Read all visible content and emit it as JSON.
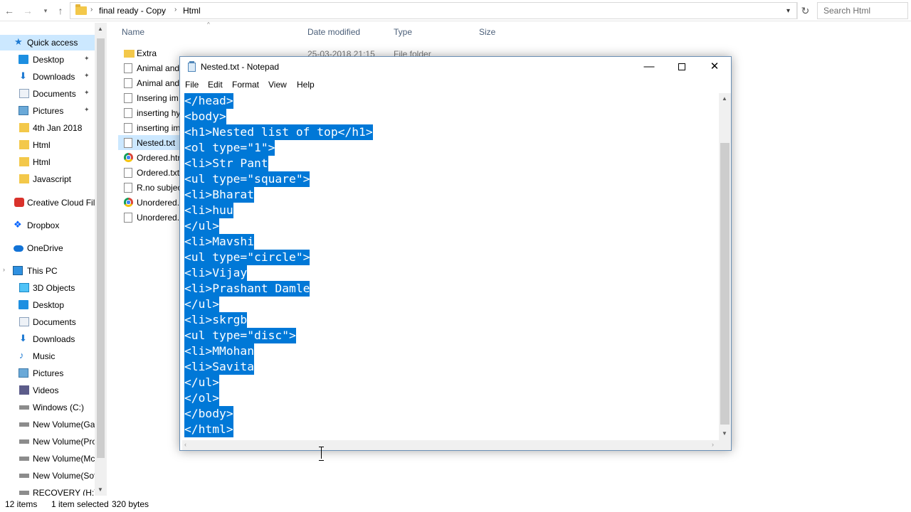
{
  "explorer": {
    "breadcrumb": [
      "final ready - Copy",
      "Html"
    ],
    "search_placeholder": "Search Html",
    "columns": {
      "name": "Name",
      "date": "Date modified",
      "type": "Type",
      "size": "Size"
    },
    "ghost_date": "25-03-2018 21:15",
    "ghost_type": "File folder",
    "nav": {
      "quick_access": "Quick access",
      "quick_items": [
        "Desktop",
        "Downloads",
        "Documents",
        "Pictures",
        "4th Jan 2018",
        "Html",
        "Html",
        "Javascript"
      ],
      "creative_cloud": "Creative Cloud Fil",
      "dropbox": "Dropbox",
      "onedrive": "OneDrive",
      "this_pc": "This PC",
      "pc_items": [
        "3D Objects",
        "Desktop",
        "Documents",
        "Downloads",
        "Music",
        "Pictures",
        "Videos",
        "Windows (C:)",
        "New Volume(Ga",
        "New Volume(Pro",
        "New Volume(Mc",
        "New Volume(Sof",
        "RECOVERY (H:)"
      ]
    },
    "files": [
      "Extra",
      "Animal and",
      "Animal and",
      "Insering im",
      "inserting hy",
      "inserting im",
      "Nested.txt",
      "Ordered.htr",
      "Ordered.txt",
      "R.no subjec",
      "Unordered.",
      "Unordered."
    ],
    "status": {
      "items": "12 items",
      "selected": "1 item selected",
      "size": "320 bytes"
    }
  },
  "notepad": {
    "title": "Nested.txt - Notepad",
    "menu": [
      "File",
      "Edit",
      "Format",
      "View",
      "Help"
    ],
    "lines": [
      "</head>",
      "<body>",
      "<h1>Nested list of top</h1>",
      "<ol type=\"1\">",
      "<li>Str Pant",
      "<ul type=\"square\">",
      "<li>Bharat",
      "<li>huu",
      "</ul>",
      "<li>Mavshi",
      "<ul type=\"circle\">",
      "<li>Vijay",
      "<li>Prashant Damle",
      "</ul>",
      "<li>skrgb",
      "<ul type=\"disc\">",
      "<li>MMohan",
      "<li>Savita",
      "</ul>",
      "</ol>",
      "</body>",
      "</html>"
    ]
  },
  "colors": {
    "selection": "#0078d7",
    "nav_selected": "#cce8ff",
    "header_text": "#4c607a"
  }
}
